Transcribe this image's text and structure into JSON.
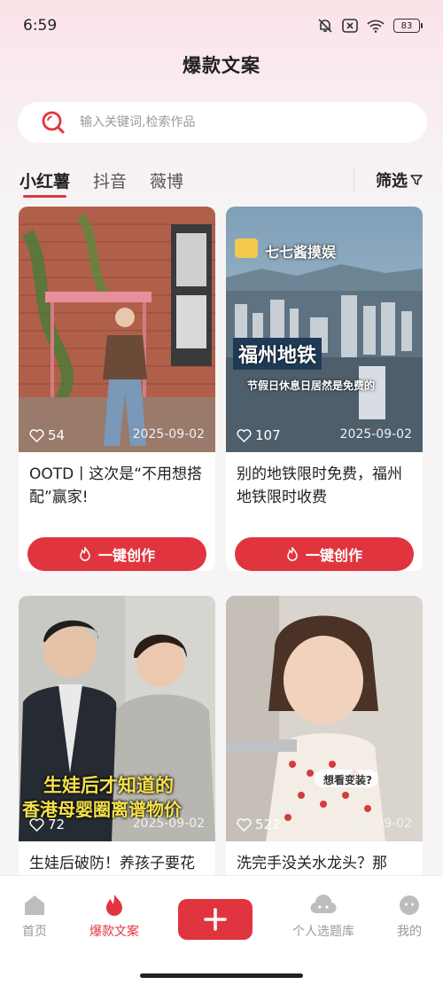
{
  "status_bar": {
    "time": "6:59",
    "battery": "83"
  },
  "header": {
    "title": "爆款文案"
  },
  "search": {
    "placeholder": "输入关键词,检索作品"
  },
  "tabs": [
    {
      "label": "小红薯",
      "active": true
    },
    {
      "label": "抖音",
      "active": false
    },
    {
      "label": "薇博",
      "active": false
    }
  ],
  "filter": {
    "label": "筛选"
  },
  "cards": [
    {
      "likes": "54",
      "date": "2025-09-02",
      "title": "OOTD丨这次是“不用想搭配”赢家!",
      "button": "一键创作"
    },
    {
      "likes": "107",
      "date": "2025-09-02",
      "title": "别的地铁限时免费，福州地铁限时收费",
      "button": "一键创作",
      "image_text": {
        "channel": "七七酱摸娱",
        "headline": "福州地铁",
        "caption": "节假日休息日居然是免费的"
      }
    },
    {
      "likes": "72",
      "date": "2025-09-02",
      "title": "生娃后破防！养孩子要花",
      "image_text": {
        "line1": "生娃后才知道的",
        "line2": "香港母婴圈离谱物价"
      }
    },
    {
      "likes": "522",
      "date": "2025-09-02",
      "title": "洗完手没关水龙头？那",
      "image_text": {
        "bubble": "想看变装?"
      }
    }
  ],
  "bottom_nav": [
    {
      "label": "首页",
      "icon": "home-icon"
    },
    {
      "label": "爆款文案",
      "icon": "flame-icon",
      "active": true
    },
    {
      "label": "",
      "icon": "plus-icon"
    },
    {
      "label": "个人选题库",
      "icon": "cloud-face-icon"
    },
    {
      "label": "我的",
      "icon": "profile-icon"
    }
  ],
  "colors": {
    "accent": "#e0353f"
  }
}
